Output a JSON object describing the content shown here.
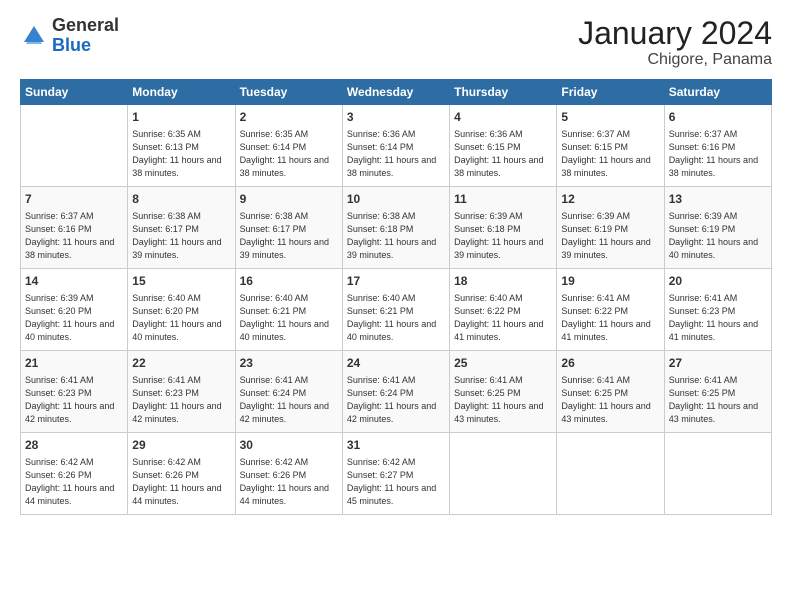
{
  "logo": {
    "general": "General",
    "blue": "Blue"
  },
  "title": "January 2024",
  "subtitle": "Chigore, Panama",
  "days_of_week": [
    "Sunday",
    "Monday",
    "Tuesday",
    "Wednesday",
    "Thursday",
    "Friday",
    "Saturday"
  ],
  "weeks": [
    [
      {
        "num": "",
        "sunrise": "",
        "sunset": "",
        "daylight": ""
      },
      {
        "num": "1",
        "sunrise": "Sunrise: 6:35 AM",
        "sunset": "Sunset: 6:13 PM",
        "daylight": "Daylight: 11 hours and 38 minutes."
      },
      {
        "num": "2",
        "sunrise": "Sunrise: 6:35 AM",
        "sunset": "Sunset: 6:14 PM",
        "daylight": "Daylight: 11 hours and 38 minutes."
      },
      {
        "num": "3",
        "sunrise": "Sunrise: 6:36 AM",
        "sunset": "Sunset: 6:14 PM",
        "daylight": "Daylight: 11 hours and 38 minutes."
      },
      {
        "num": "4",
        "sunrise": "Sunrise: 6:36 AM",
        "sunset": "Sunset: 6:15 PM",
        "daylight": "Daylight: 11 hours and 38 minutes."
      },
      {
        "num": "5",
        "sunrise": "Sunrise: 6:37 AM",
        "sunset": "Sunset: 6:15 PM",
        "daylight": "Daylight: 11 hours and 38 minutes."
      },
      {
        "num": "6",
        "sunrise": "Sunrise: 6:37 AM",
        "sunset": "Sunset: 6:16 PM",
        "daylight": "Daylight: 11 hours and 38 minutes."
      }
    ],
    [
      {
        "num": "7",
        "sunrise": "Sunrise: 6:37 AM",
        "sunset": "Sunset: 6:16 PM",
        "daylight": "Daylight: 11 hours and 38 minutes."
      },
      {
        "num": "8",
        "sunrise": "Sunrise: 6:38 AM",
        "sunset": "Sunset: 6:17 PM",
        "daylight": "Daylight: 11 hours and 39 minutes."
      },
      {
        "num": "9",
        "sunrise": "Sunrise: 6:38 AM",
        "sunset": "Sunset: 6:17 PM",
        "daylight": "Daylight: 11 hours and 39 minutes."
      },
      {
        "num": "10",
        "sunrise": "Sunrise: 6:38 AM",
        "sunset": "Sunset: 6:18 PM",
        "daylight": "Daylight: 11 hours and 39 minutes."
      },
      {
        "num": "11",
        "sunrise": "Sunrise: 6:39 AM",
        "sunset": "Sunset: 6:18 PM",
        "daylight": "Daylight: 11 hours and 39 minutes."
      },
      {
        "num": "12",
        "sunrise": "Sunrise: 6:39 AM",
        "sunset": "Sunset: 6:19 PM",
        "daylight": "Daylight: 11 hours and 39 minutes."
      },
      {
        "num": "13",
        "sunrise": "Sunrise: 6:39 AM",
        "sunset": "Sunset: 6:19 PM",
        "daylight": "Daylight: 11 hours and 40 minutes."
      }
    ],
    [
      {
        "num": "14",
        "sunrise": "Sunrise: 6:39 AM",
        "sunset": "Sunset: 6:20 PM",
        "daylight": "Daylight: 11 hours and 40 minutes."
      },
      {
        "num": "15",
        "sunrise": "Sunrise: 6:40 AM",
        "sunset": "Sunset: 6:20 PM",
        "daylight": "Daylight: 11 hours and 40 minutes."
      },
      {
        "num": "16",
        "sunrise": "Sunrise: 6:40 AM",
        "sunset": "Sunset: 6:21 PM",
        "daylight": "Daylight: 11 hours and 40 minutes."
      },
      {
        "num": "17",
        "sunrise": "Sunrise: 6:40 AM",
        "sunset": "Sunset: 6:21 PM",
        "daylight": "Daylight: 11 hours and 40 minutes."
      },
      {
        "num": "18",
        "sunrise": "Sunrise: 6:40 AM",
        "sunset": "Sunset: 6:22 PM",
        "daylight": "Daylight: 11 hours and 41 minutes."
      },
      {
        "num": "19",
        "sunrise": "Sunrise: 6:41 AM",
        "sunset": "Sunset: 6:22 PM",
        "daylight": "Daylight: 11 hours and 41 minutes."
      },
      {
        "num": "20",
        "sunrise": "Sunrise: 6:41 AM",
        "sunset": "Sunset: 6:23 PM",
        "daylight": "Daylight: 11 hours and 41 minutes."
      }
    ],
    [
      {
        "num": "21",
        "sunrise": "Sunrise: 6:41 AM",
        "sunset": "Sunset: 6:23 PM",
        "daylight": "Daylight: 11 hours and 42 minutes."
      },
      {
        "num": "22",
        "sunrise": "Sunrise: 6:41 AM",
        "sunset": "Sunset: 6:23 PM",
        "daylight": "Daylight: 11 hours and 42 minutes."
      },
      {
        "num": "23",
        "sunrise": "Sunrise: 6:41 AM",
        "sunset": "Sunset: 6:24 PM",
        "daylight": "Daylight: 11 hours and 42 minutes."
      },
      {
        "num": "24",
        "sunrise": "Sunrise: 6:41 AM",
        "sunset": "Sunset: 6:24 PM",
        "daylight": "Daylight: 11 hours and 42 minutes."
      },
      {
        "num": "25",
        "sunrise": "Sunrise: 6:41 AM",
        "sunset": "Sunset: 6:25 PM",
        "daylight": "Daylight: 11 hours and 43 minutes."
      },
      {
        "num": "26",
        "sunrise": "Sunrise: 6:41 AM",
        "sunset": "Sunset: 6:25 PM",
        "daylight": "Daylight: 11 hours and 43 minutes."
      },
      {
        "num": "27",
        "sunrise": "Sunrise: 6:41 AM",
        "sunset": "Sunset: 6:25 PM",
        "daylight": "Daylight: 11 hours and 43 minutes."
      }
    ],
    [
      {
        "num": "28",
        "sunrise": "Sunrise: 6:42 AM",
        "sunset": "Sunset: 6:26 PM",
        "daylight": "Daylight: 11 hours and 44 minutes."
      },
      {
        "num": "29",
        "sunrise": "Sunrise: 6:42 AM",
        "sunset": "Sunset: 6:26 PM",
        "daylight": "Daylight: 11 hours and 44 minutes."
      },
      {
        "num": "30",
        "sunrise": "Sunrise: 6:42 AM",
        "sunset": "Sunset: 6:26 PM",
        "daylight": "Daylight: 11 hours and 44 minutes."
      },
      {
        "num": "31",
        "sunrise": "Sunrise: 6:42 AM",
        "sunset": "Sunset: 6:27 PM",
        "daylight": "Daylight: 11 hours and 45 minutes."
      },
      {
        "num": "",
        "sunrise": "",
        "sunset": "",
        "daylight": ""
      },
      {
        "num": "",
        "sunrise": "",
        "sunset": "",
        "daylight": ""
      },
      {
        "num": "",
        "sunrise": "",
        "sunset": "",
        "daylight": ""
      }
    ]
  ]
}
